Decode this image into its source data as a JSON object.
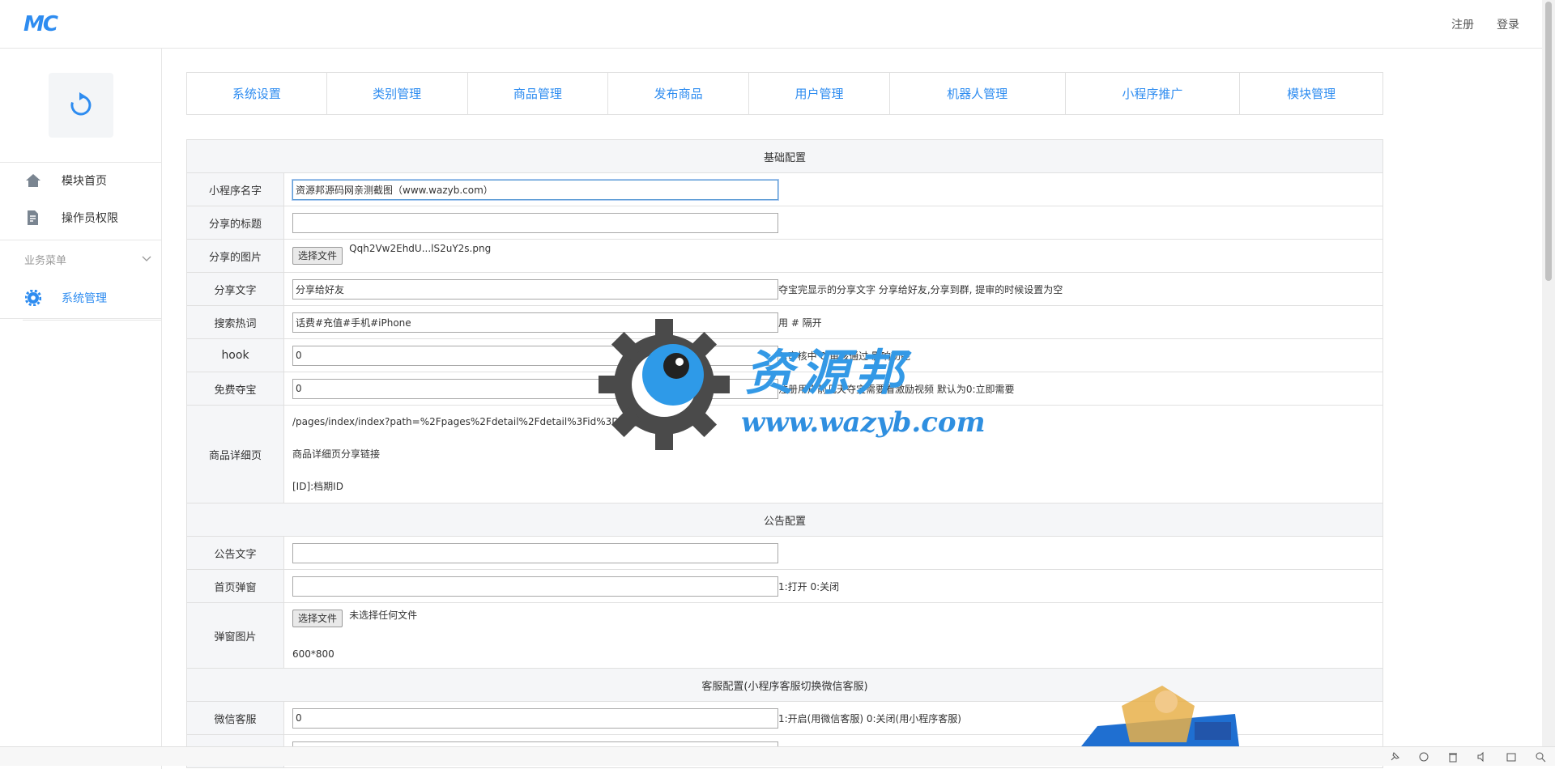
{
  "header": {
    "logo_text": "MC",
    "register_label": "注册",
    "login_label": "登录"
  },
  "sidebar": {
    "items": [
      {
        "label": "模块首页",
        "icon": "home-icon"
      },
      {
        "label": "操作员权限",
        "icon": "document-edit-icon"
      }
    ],
    "group_label": "业务菜单",
    "active_item": {
      "label": "系统管理",
      "icon": "gear-icon"
    }
  },
  "tabs": [
    "系统设置",
    "类别管理",
    "商品管理",
    "发布商品",
    "用户管理",
    "机器人管理",
    "小程序推广",
    "模块管理"
  ],
  "form": {
    "section_basic": "基础配置",
    "app_name_label": "小程序名字",
    "app_name_value": "资源邦源码网亲测截图（www.wazyb.com）",
    "share_title_label": "分享的标题",
    "share_title_value": "",
    "share_image_label": "分享的图片",
    "share_image_button": "选择文件",
    "share_image_file": "Qqh2Vw2EhdU...lS2uY2s.png",
    "share_text_label": "分享文字",
    "share_text_value": "分享给好友",
    "share_text_hint": "夺宝完显示的分享文字 分享给好友,分享到群, 提审的时候设置为空",
    "hot_search_label": "搜索热词",
    "hot_search_value": "话费#充值#手机#iPhone",
    "hot_search_hint": "用 # 隔开",
    "hook_label": "hook",
    "hook_value": "0",
    "hook_hint": "1:审核中 0:审核通过 影响功能",
    "free_label": "免费夺宝",
    "free_value": "0",
    "free_hint": "注册用户前几天夺宝需要看激励视频 默认为0:立即需要",
    "detail_label": "商品详细页",
    "detail_path": "/pages/index/index?path=%2Fpages%2Fdetail%2Fdetail%3Fid%3D[ID]",
    "detail_desc": "商品详细页分享链接",
    "detail_id_note": "[ID]:档期ID",
    "section_notice": "公告配置",
    "notice_text_label": "公告文字",
    "notice_text_value": "",
    "home_popup_label": "首页弹窗",
    "home_popup_value": "",
    "home_popup_hint": "1:打开 0:关闭",
    "popup_image_label": "弹窗图片",
    "popup_image_button": "选择文件",
    "popup_image_file": "未选择任何文件",
    "popup_image_size": "600*800",
    "section_service": "客服配置(小程序客服切换微信客服)",
    "wechat_service_label": "微信客服",
    "wechat_service_value": "0",
    "wechat_service_hint": "1:开启(用微信客服) 0:关闭(用小程序客服)"
  },
  "watermark": {
    "title": "资源邦",
    "url": "www.wazyb.com"
  },
  "colors": {
    "accent": "#2e8cf0",
    "section_bg": "#f5f6f8",
    "border": "#e0e0e0"
  }
}
